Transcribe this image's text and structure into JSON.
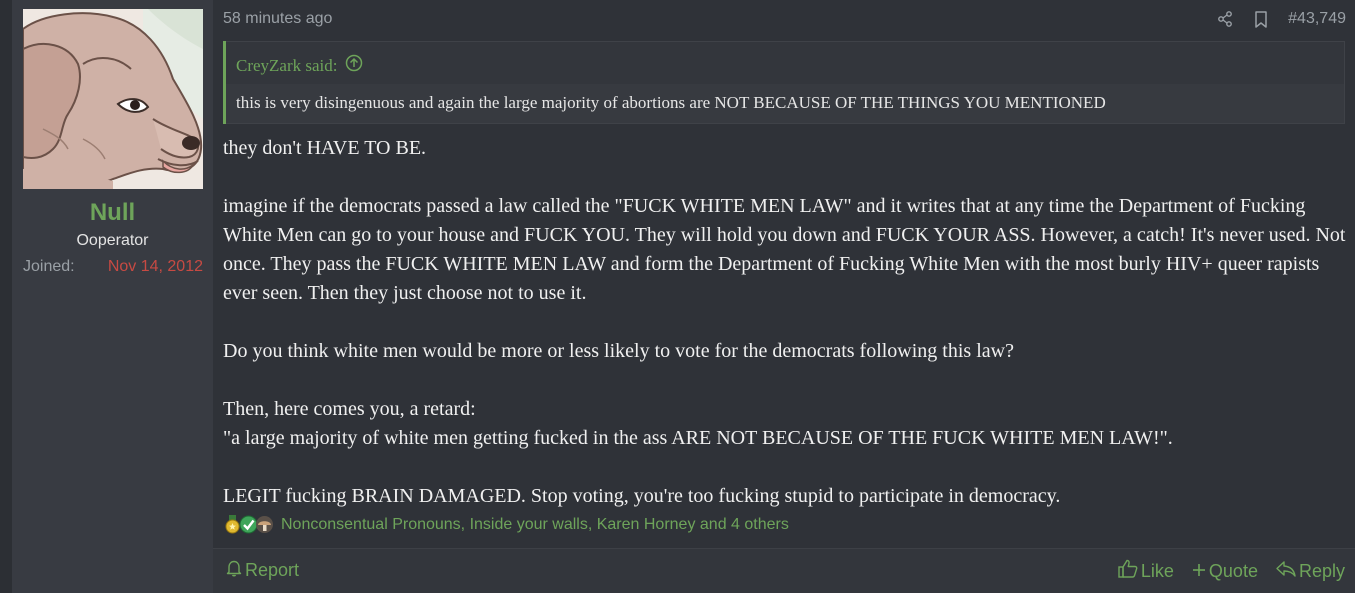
{
  "user": {
    "name": "Null",
    "title": "Ooperator",
    "joined_label": "Joined:",
    "joined_date": "Nov 14, 2012"
  },
  "post": {
    "time": "58 minutes ago",
    "number": "#43,749",
    "quote": {
      "author": "CreyZark said:",
      "text": "this is very disingenuous and again the large majority of abortions are NOT BECAUSE OF THE THINGS YOU MENTIONED"
    },
    "paragraphs": [
      "they don't HAVE TO BE.",
      "imagine if the democrats passed a law called the \"FUCK WHITE MEN LAW\" and it writes that at any time the Department of Fucking White Men can go to your house and FUCK YOU. They will hold you down and FUCK YOUR ASS. However, a catch! It's never used. Not once. They pass the FUCK WHITE MEN LAW and form the Department of Fucking White Men with the most burly HIV+ queer rapists ever seen. Then they just choose not to use it.",
      "Do you think white men would be more or less likely to vote for the democrats following this law?",
      "Then, here comes you, a retard:",
      "\"a large majority of white men getting fucked in the ass ARE NOT BECAUSE OF THE FUCK WHITE MEN LAW!\".",
      "LEGIT fucking BRAIN DAMAGED. Stop voting, you're too fucking stupid to participate in democracy."
    ],
    "reactions_text": "Nonconsentual Pronouns, Inside your walls, Karen Horney and 4 others",
    "reaction_icons": [
      "medal-icon",
      "check-badge-icon",
      "mushroom-icon"
    ]
  },
  "actions": {
    "report": "Report",
    "like": "Like",
    "quote": "Quote",
    "reply": "Reply"
  },
  "colors": {
    "accent": "#6ea45a",
    "joined_date": "#c74a43",
    "background": "#2f3238",
    "sidebar": "#383b42"
  }
}
